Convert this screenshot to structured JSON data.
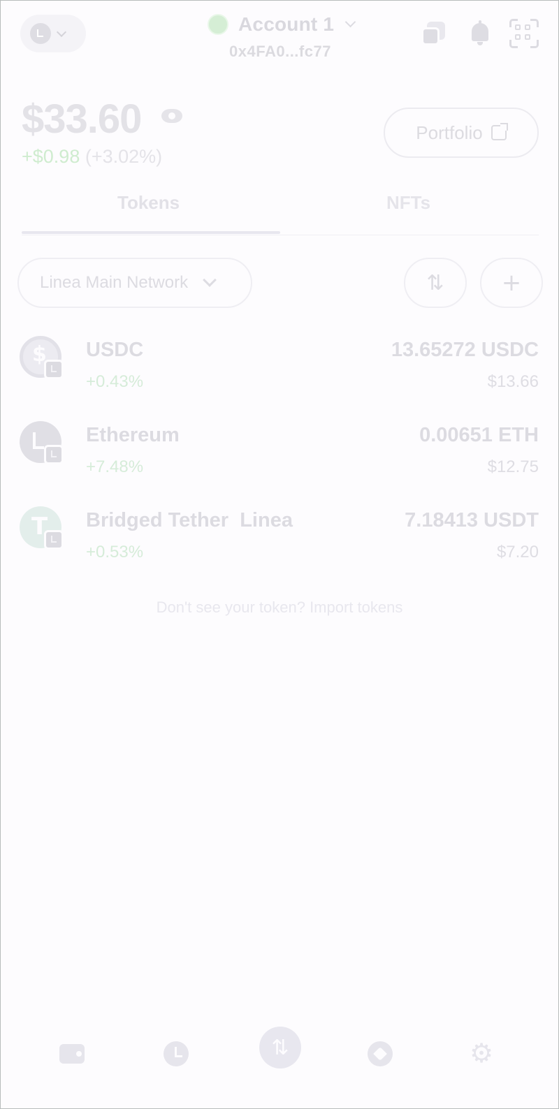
{
  "header": {
    "account_name": "Account 1",
    "account_address": "0x4FA0...fc77"
  },
  "balance": {
    "total": "$33.60",
    "change_amount": "+$0.98",
    "change_percent": "(+3.02%)"
  },
  "portfolio_button": {
    "label": "Portfolio"
  },
  "tabs": [
    {
      "label": "Tokens",
      "active": true
    },
    {
      "label": "NFTs",
      "active": false
    }
  ],
  "network_filter": {
    "label": "Linea Main Network"
  },
  "tokens": [
    {
      "name": "USDC",
      "change": "+0.43%",
      "amount": "13.65272 USDC",
      "fiat": "$13.66",
      "icon": "usdc-icon"
    },
    {
      "name": "Ethereum",
      "change": "+7.48%",
      "amount": "0.00651 ETH",
      "fiat": "$12.75",
      "icon": "ethereum-icon"
    },
    {
      "name": "Bridged Tether  Linea",
      "change": "+0.53%",
      "amount": "7.18413 USDT",
      "fiat": "$7.20",
      "icon": "tether-icon"
    }
  ],
  "import_prompt": "Don't see your token? Import tokens",
  "bottom_nav": [
    {
      "name": "wallet",
      "icon": "wallet-icon"
    },
    {
      "name": "activity",
      "icon": "clock-icon"
    },
    {
      "name": "trade",
      "icon": "swap-arrows-icon"
    },
    {
      "name": "explore",
      "icon": "compass-icon"
    },
    {
      "name": "settings",
      "icon": "gear-icon"
    }
  ],
  "colors": {
    "background": "#fdfcfe",
    "positive": "#cfeccf",
    "muted_text": "#dcdbe1"
  }
}
